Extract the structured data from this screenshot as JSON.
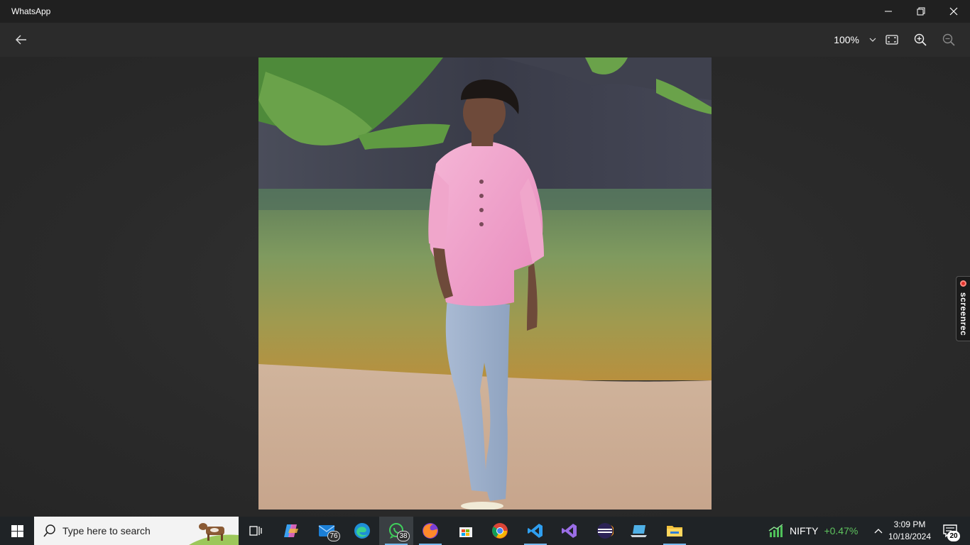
{
  "window": {
    "title": "WhatsApp",
    "minimize_icon": "minimize-icon",
    "restore_icon": "restore-icon",
    "close_icon": "close-icon"
  },
  "viewer": {
    "back_icon": "back-arrow-icon",
    "zoom_level": "100%",
    "zoom_dropdown_icon": "chevron-down-icon",
    "fit_icon": "fit-to-window-icon",
    "zoom_in_icon": "zoom-in-icon",
    "zoom_out_icon": "zoom-out-icon",
    "photo_description_icon": "photo"
  },
  "screenrec": {
    "label": "screenrec",
    "dot_color": "#e0302a"
  },
  "taskbar": {
    "start_icon": "windows-start-icon",
    "search_placeholder": "Type here to search",
    "apps": [
      {
        "name": "task-view",
        "badge": ""
      },
      {
        "name": "copilot",
        "badge": ""
      },
      {
        "name": "mail",
        "badge": "76"
      },
      {
        "name": "edge",
        "badge": ""
      },
      {
        "name": "whatsapp",
        "badge": "38"
      },
      {
        "name": "firefox",
        "badge": ""
      },
      {
        "name": "microsoft-store",
        "badge": ""
      },
      {
        "name": "chrome",
        "badge": ""
      },
      {
        "name": "vscode",
        "badge": ""
      },
      {
        "name": "visual-studio",
        "badge": ""
      },
      {
        "name": "eclipse",
        "badge": ""
      },
      {
        "name": "laptop-app",
        "badge": ""
      },
      {
        "name": "file-explorer",
        "badge": ""
      }
    ],
    "nifty": {
      "name": "NIFTY",
      "change": "+0.47%",
      "change_color": "#5ec35e"
    },
    "time": "3:09 PM",
    "date": "10/18/2024",
    "notifications_count": "20"
  }
}
